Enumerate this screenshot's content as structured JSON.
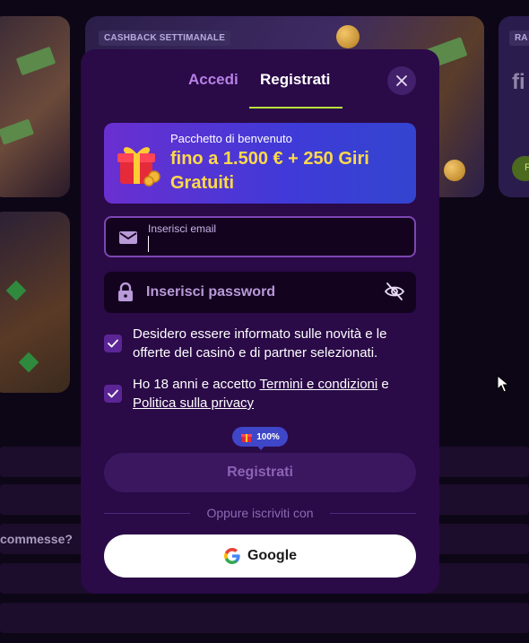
{
  "background": {
    "promo_tag": "CASHBACK SETTIMANALE",
    "promo_tag2": "RA",
    "side_heading": "fi",
    "side_pill": "P",
    "faq_question": "commesse?"
  },
  "modal": {
    "tabs": [
      {
        "label": "Accedi",
        "active": false
      },
      {
        "label": "Registrati",
        "active": true
      }
    ],
    "promo": {
      "small": "Pacchetto di benvenuto",
      "big": "fino a 1.500 € + 250 Giri Gratuiti"
    },
    "email": {
      "label": "Inserisci email",
      "value": ""
    },
    "password": {
      "placeholder": "Inserisci password"
    },
    "consent_news": "Desidero essere informato sulle novità e le offerte del casinò e di partner selezionati.",
    "consent_age": {
      "prefix": "Ho 18 anni e accetto ",
      "terms_link": "Termini e condizioni",
      "middle": " e",
      "privacy_link": "Politica sulla privacy",
      "checked": true
    },
    "bonus_badge": "100%",
    "submit_label": "Registrati",
    "divider_text": "Oppure iscriviti con",
    "google_label": "Google"
  },
  "colors": {
    "accent_green": "#b8e43c",
    "modal_bg": "#2a0a47",
    "promo_yellow": "#ffd94a"
  }
}
